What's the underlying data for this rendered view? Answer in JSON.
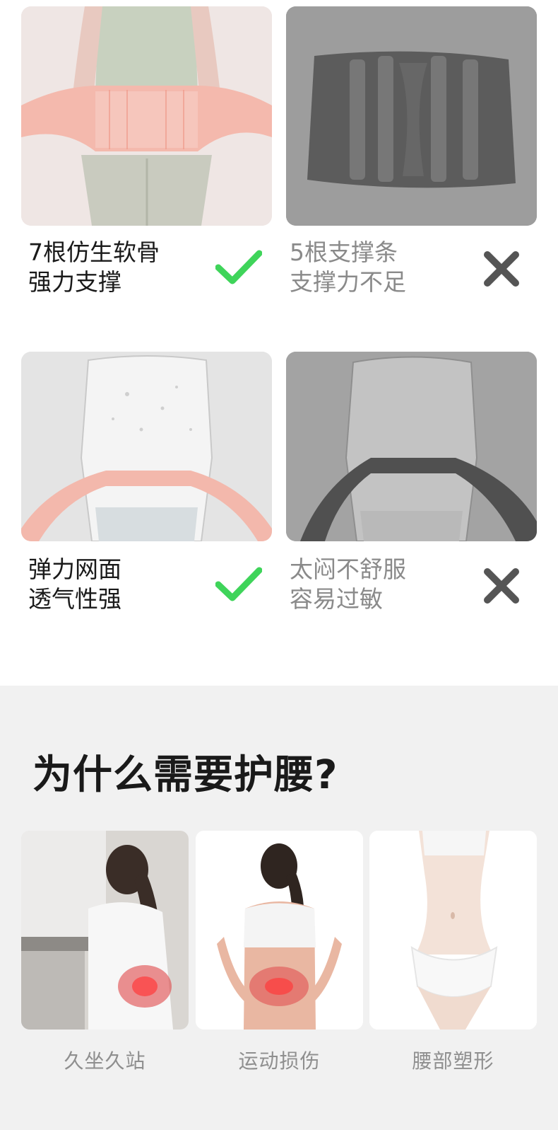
{
  "comparisons": [
    {
      "good": {
        "line1": "7根仿生软骨",
        "line2": "强力支撑"
      },
      "bad": {
        "line1": "5根支撑条",
        "line2": "支撑力不足"
      }
    },
    {
      "good": {
        "line1": "弹力网面",
        "line2": "透气性强"
      },
      "bad": {
        "line1": "太闷不舒服",
        "line2": "容易过敏"
      }
    }
  ],
  "why": {
    "title": "为什么需要护腰?",
    "reasons": [
      {
        "label": "久坐久站"
      },
      {
        "label": "运动损伤"
      },
      {
        "label": "腰部塑形"
      }
    ]
  },
  "colors": {
    "check": "#3fd45a",
    "cross": "#555555",
    "pink": "#f3b8ac",
    "gray_belt": "#5a5a5a"
  }
}
